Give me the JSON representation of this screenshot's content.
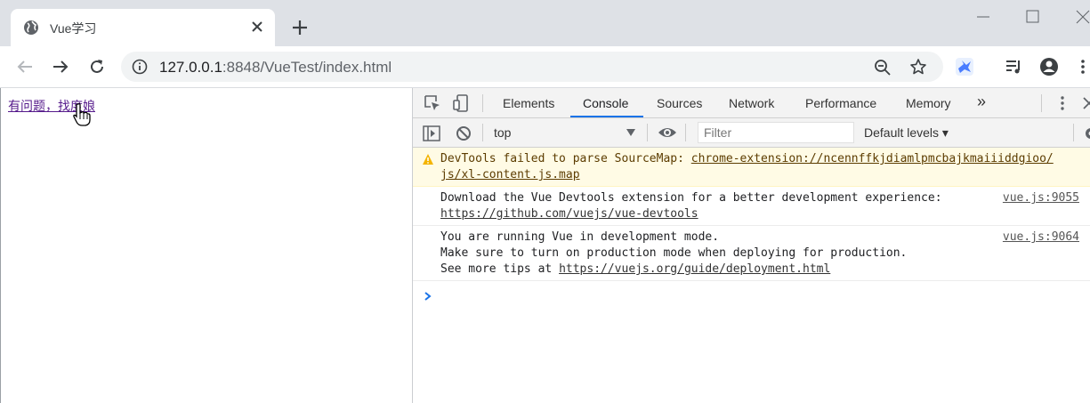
{
  "browser": {
    "tab": {
      "title": "Vue学习"
    },
    "url": {
      "host": "127.0.0.1",
      "rest": ":8848/VueTest/index.html"
    }
  },
  "page": {
    "link_text": "有问题，找度娘"
  },
  "devtools": {
    "tabs": [
      "Elements",
      "Console",
      "Sources",
      "Network",
      "Performance",
      "Memory"
    ],
    "active_tab": "Console",
    "more_tabs": "»",
    "context": "top",
    "filter_placeholder": "Filter",
    "levels": "Default levels",
    "messages": {
      "warning": {
        "prefix": "DevTools failed to parse SourceMap: ",
        "link_line1": "chrome-extension://ncennffkjdiamlpmcbajkmaiiiddgioo/",
        "link_line2": "js/xl-content.js.map"
      },
      "info1": {
        "text": "Download the Vue Devtools extension for a better development experience:",
        "link": "https://github.com/vuejs/vue-devtools",
        "source": "vue.js:9055"
      },
      "info2": {
        "line1": "You are running Vue in development mode.",
        "line2": "Make sure to turn on production mode when deploying for production.",
        "line3_prefix": "See more tips at ",
        "link": "https://vuejs.org/guide/deployment.html",
        "source": "vue.js:9064"
      }
    }
  },
  "colors": {
    "accent": "#1a73e8",
    "warning_bg": "#fffbe5",
    "visited_link": "#551a8b"
  },
  "icons": [
    "globe-icon",
    "close-icon",
    "plus-icon",
    "minimize-icon",
    "maximize-icon",
    "close-window-icon",
    "back-icon",
    "forward-icon",
    "reload-icon",
    "info-icon",
    "zoom-icon",
    "star-icon",
    "extension-icon",
    "media-icon",
    "profile-icon",
    "menu-icon",
    "inspect-icon",
    "device-icon",
    "sidebar-icon",
    "clear-icon",
    "eye-icon",
    "warning-icon",
    "prompt-icon"
  ]
}
